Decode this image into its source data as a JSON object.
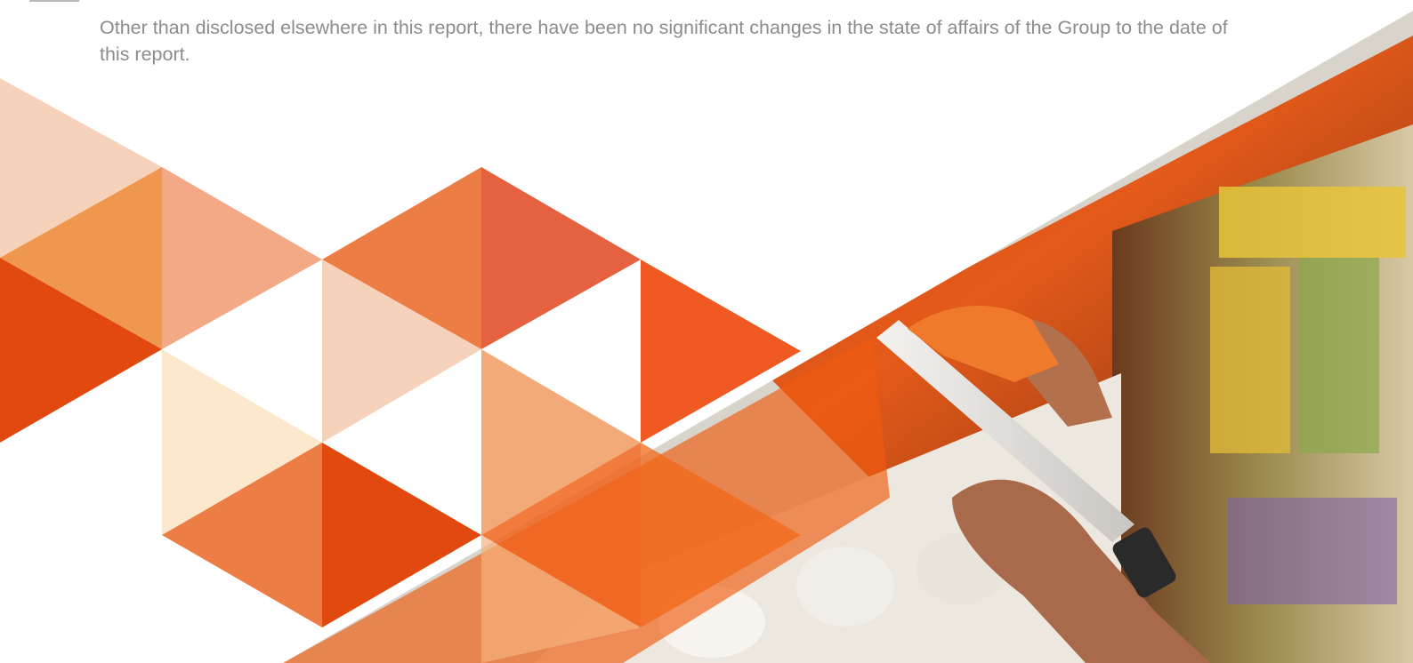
{
  "page": {
    "body_text": "Other than disclosed elsewhere in this report, there have been no significant changes in the state of affairs of the Group to the date of this report."
  },
  "artwork": {
    "description_icon": "triangle-mosaic",
    "photo_icon": "shelf-photo",
    "colors": {
      "peach_light": "#f7d2bb",
      "peach": "#f3a886",
      "orange": "#f0974f",
      "orange_mid": "#ec7d45",
      "red_orange": "#e5613f",
      "deep_orange": "#e2490f",
      "cream": "#fce8cc",
      "tan": "#f2ab78"
    }
  }
}
